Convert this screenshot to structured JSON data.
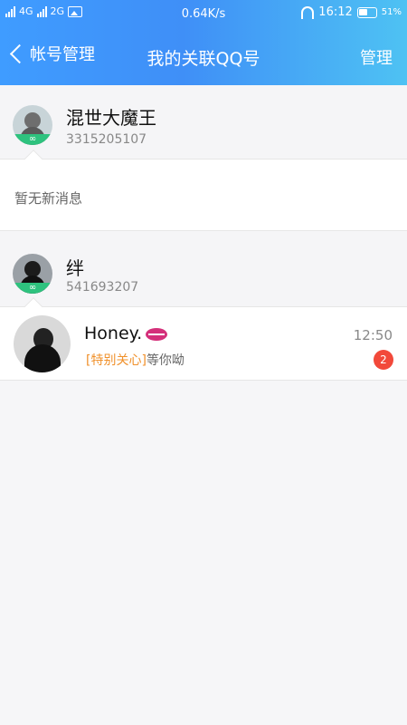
{
  "statusbar": {
    "net1": "4G",
    "net2": "2G",
    "speed": "0.64K/s",
    "time": "16:12",
    "battery": "51%"
  },
  "navbar": {
    "back_label": "帐号管理",
    "title": "我的关联QQ号",
    "manage_label": "管理"
  },
  "accounts": [
    {
      "name": "混世大魔王",
      "qq": "3315205107",
      "ring_icon": "infinity-icon"
    },
    {
      "name": "绊",
      "qq": "541693207",
      "ring_icon": "infinity-icon"
    }
  ],
  "empty_message": "暂无新消息",
  "chat": {
    "name": "Honey.",
    "time": "12:50",
    "tag": "[特别关心]",
    "preview": "等你呦",
    "unread": "2"
  },
  "colors": {
    "header_start": "#3f9cff",
    "header_end": "#4ec2f3",
    "badge": "#f2493a",
    "tag": "#f0902a"
  }
}
